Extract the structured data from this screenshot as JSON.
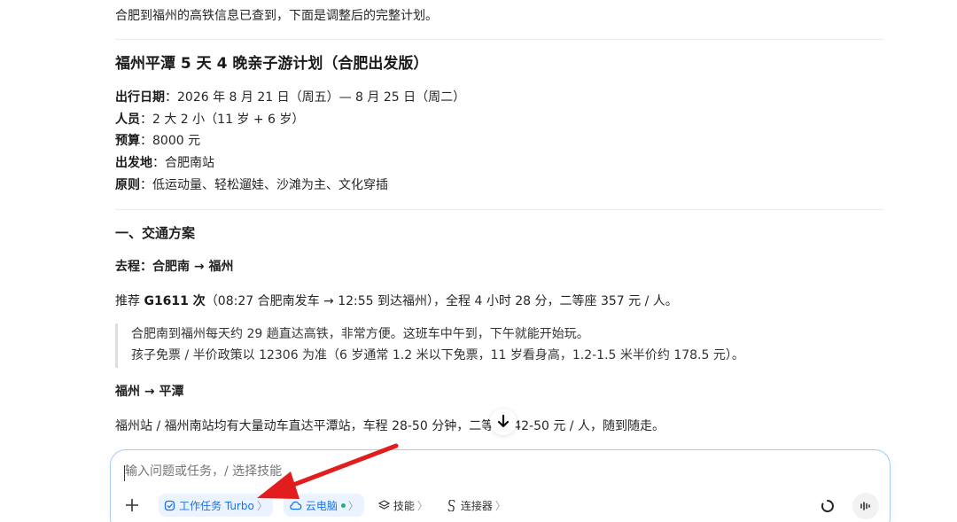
{
  "intro": "合肥到福州的高铁信息已查到，下面是调整后的完整计划。",
  "plan_title": "福州平潭 5 天 4 晚亲子游计划（合肥出发版）",
  "meta": [
    {
      "label": "出行日期",
      "sep": "：",
      "value": "2026 年 8 月 21 日（周五）— 8 月 25 日（周二）"
    },
    {
      "label": "人员",
      "sep": "：",
      "value": "2 大 2 小（11 岁 + 6 岁）"
    },
    {
      "label": "预算",
      "sep": "：",
      "value": "8000 元"
    },
    {
      "label": "出发地",
      "sep": "：",
      "value": "合肥南站"
    },
    {
      "label": "原则",
      "sep": "：",
      "value": "低运动量、轻松遛娃、沙滩为主、文化穿插"
    }
  ],
  "section_transport": "一、交通方案",
  "outbound_title": "去程：合肥南 → 福州",
  "recommend": {
    "prefix": "推荐 ",
    "train": "G1611 次",
    "detail": "（08:27 合肥南发车 → 12:55 到达福州），全程 4 小时 28 分，二等座 357 元 / 人。"
  },
  "quote": [
    "合肥南到福州每天约 29 趟直达高铁，非常方便。这班车中午到，下午就能开始玩。",
    "孩子免票 / 半价政策以 12306 为准（6 岁通常 1.2 米以下免票，11 岁看身高，1.2-1.5 米半价约 178.5 元）。"
  ],
  "transfer_title": "福州 → 平潭",
  "transfer_text_a": "福州站 / 福州南站均有大量动车直达平潭站，车程 28-50 分钟，二等",
  "transfer_text_b": "42-50 元 / 人，随到随走。",
  "composer": {
    "placeholder": "输入问题或任务，/ 选择技能",
    "task_chip": "工作任务 Turbo",
    "cloud_chip": "云电脑",
    "skills": "技能",
    "connectors": "连接器"
  },
  "colors": {
    "accent_blue": "#1a73e8",
    "arrow_red": "#e11d1d",
    "online_green": "#24b36b"
  }
}
